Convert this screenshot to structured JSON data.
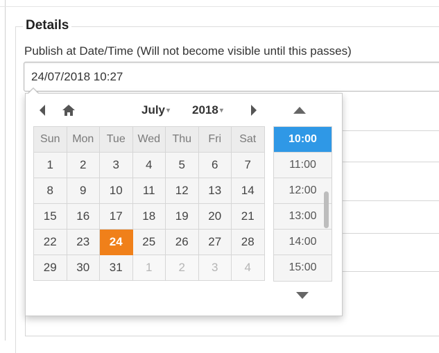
{
  "section": {
    "legend": "Details"
  },
  "publish_field": {
    "label": "Publish at Date/Time (Will not become visible until this passes)",
    "value": "24/07/2018 10:27"
  },
  "picker": {
    "month": "July",
    "year": "2018",
    "weekdays": [
      "Sun",
      "Mon",
      "Tue",
      "Wed",
      "Thu",
      "Fri",
      "Sat"
    ],
    "weeks": [
      [
        "1",
        "2",
        "3",
        "4",
        "5",
        "6",
        "7"
      ],
      [
        "8",
        "9",
        "10",
        "11",
        "12",
        "13",
        "14"
      ],
      [
        "15",
        "16",
        "17",
        "18",
        "19",
        "20",
        "21"
      ],
      [
        "22",
        "23",
        "24",
        "25",
        "26",
        "27",
        "28"
      ],
      [
        "29",
        "30",
        "31",
        "1",
        "2",
        "3",
        "4"
      ]
    ],
    "selected_day": "24",
    "today_color": "#f0801a",
    "times": [
      "10:00",
      "11:00",
      "12:00",
      "13:00",
      "14:00",
      "15:00"
    ],
    "selected_time": "10:00",
    "selected_time_color": "#2f98e6",
    "icons": {
      "prev": "triangle-left-icon",
      "home": "home-icon",
      "next": "triangle-right-icon",
      "time_up": "triangle-up-icon",
      "time_down": "triangle-down-icon"
    }
  }
}
